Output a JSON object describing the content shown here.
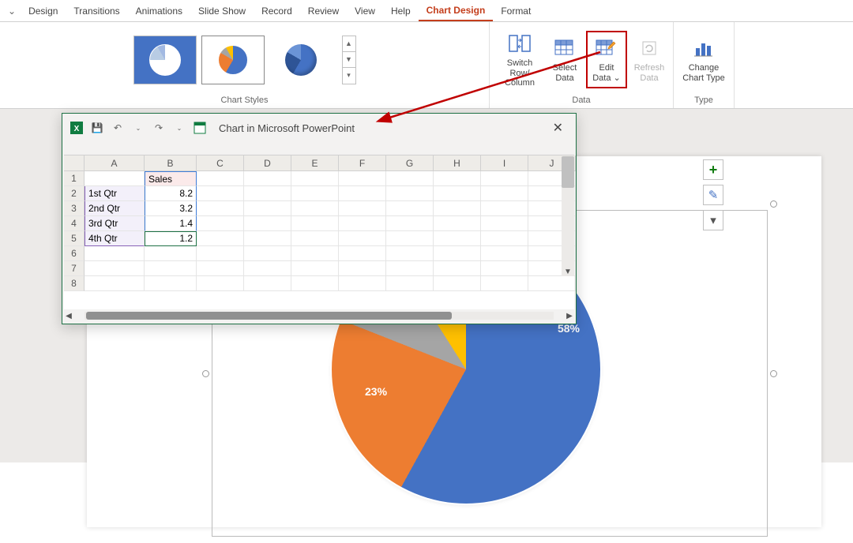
{
  "ribbon_tabs": {
    "design": "Design",
    "transitions": "Transitions",
    "animations": "Animations",
    "slide_show": "Slide Show",
    "record": "Record",
    "review": "Review",
    "view": "View",
    "help": "Help",
    "chart_design": "Chart Design",
    "format": "Format"
  },
  "ribbon_groups": {
    "chart_styles": "Chart Styles",
    "data": "Data",
    "type": "Type"
  },
  "ribbon_buttons": {
    "switch_row_col": "Switch Row/\nColumn",
    "select_data": "Select\nData",
    "edit_data": "Edit\nData ⌄",
    "refresh_data": "Refresh\nData",
    "change_chart_type": "Change\nChart Type"
  },
  "excel": {
    "title": "Chart in Microsoft PowerPoint",
    "col_headers": [
      "A",
      "B",
      "C",
      "D",
      "E",
      "F",
      "G",
      "H",
      "I",
      "J"
    ],
    "row_headers": [
      "1",
      "2",
      "3",
      "4",
      "5",
      "6",
      "7",
      "8"
    ],
    "series_header": "Sales",
    "rows": [
      {
        "label": "1st Qtr",
        "value": "8.2"
      },
      {
        "label": "2nd Qtr",
        "value": "3.2"
      },
      {
        "label": "3rd Qtr",
        "value": "1.4"
      },
      {
        "label": "4th Qtr",
        "value": "1.2"
      }
    ]
  },
  "chart_data": {
    "type": "pie",
    "title": "",
    "categories": [
      "1st Qtr",
      "2nd Qtr",
      "3rd Qtr",
      "4th Qtr"
    ],
    "values": [
      8.2,
      3.2,
      1.4,
      1.2
    ],
    "percent_labels": {
      "1st Qtr": "58%",
      "2nd Qtr": "23%"
    },
    "colors": {
      "1st Qtr": "#4472c4",
      "2nd Qtr": "#ed7d31",
      "3rd Qtr": "#a5a5a5",
      "4th Qtr": "#ffc000"
    }
  }
}
